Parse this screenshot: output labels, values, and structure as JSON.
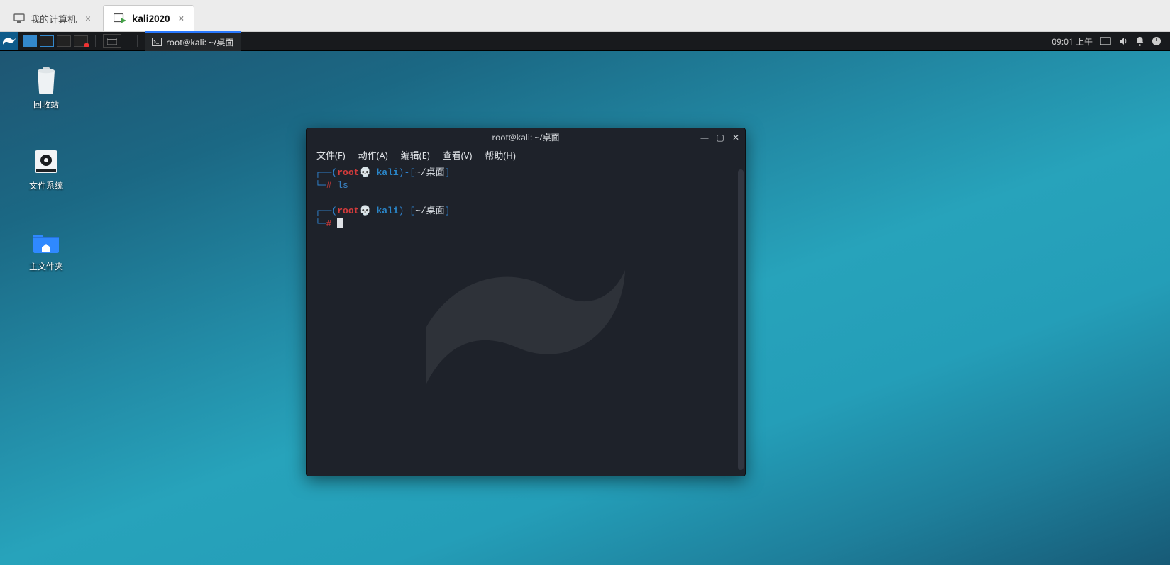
{
  "vm_tabs": {
    "my_computer": "我的计算机",
    "active": "kali2020"
  },
  "panel": {
    "task_title": "root@kali: ~/桌面",
    "clock": "09:01 上午"
  },
  "desktop": {
    "trash": "回收站",
    "fs": "文件系统",
    "home": "主文件夹"
  },
  "terminal": {
    "title": "root@kali: ~/桌面",
    "menu": {
      "file": "文件(F)",
      "action": "动作(A)",
      "edit": "编辑(E)",
      "view": "查看(V)",
      "help": "帮助(H)"
    },
    "prompt": {
      "user": "root",
      "host": "kali",
      "path": "~/桌面",
      "cmd1": "ls"
    }
  }
}
